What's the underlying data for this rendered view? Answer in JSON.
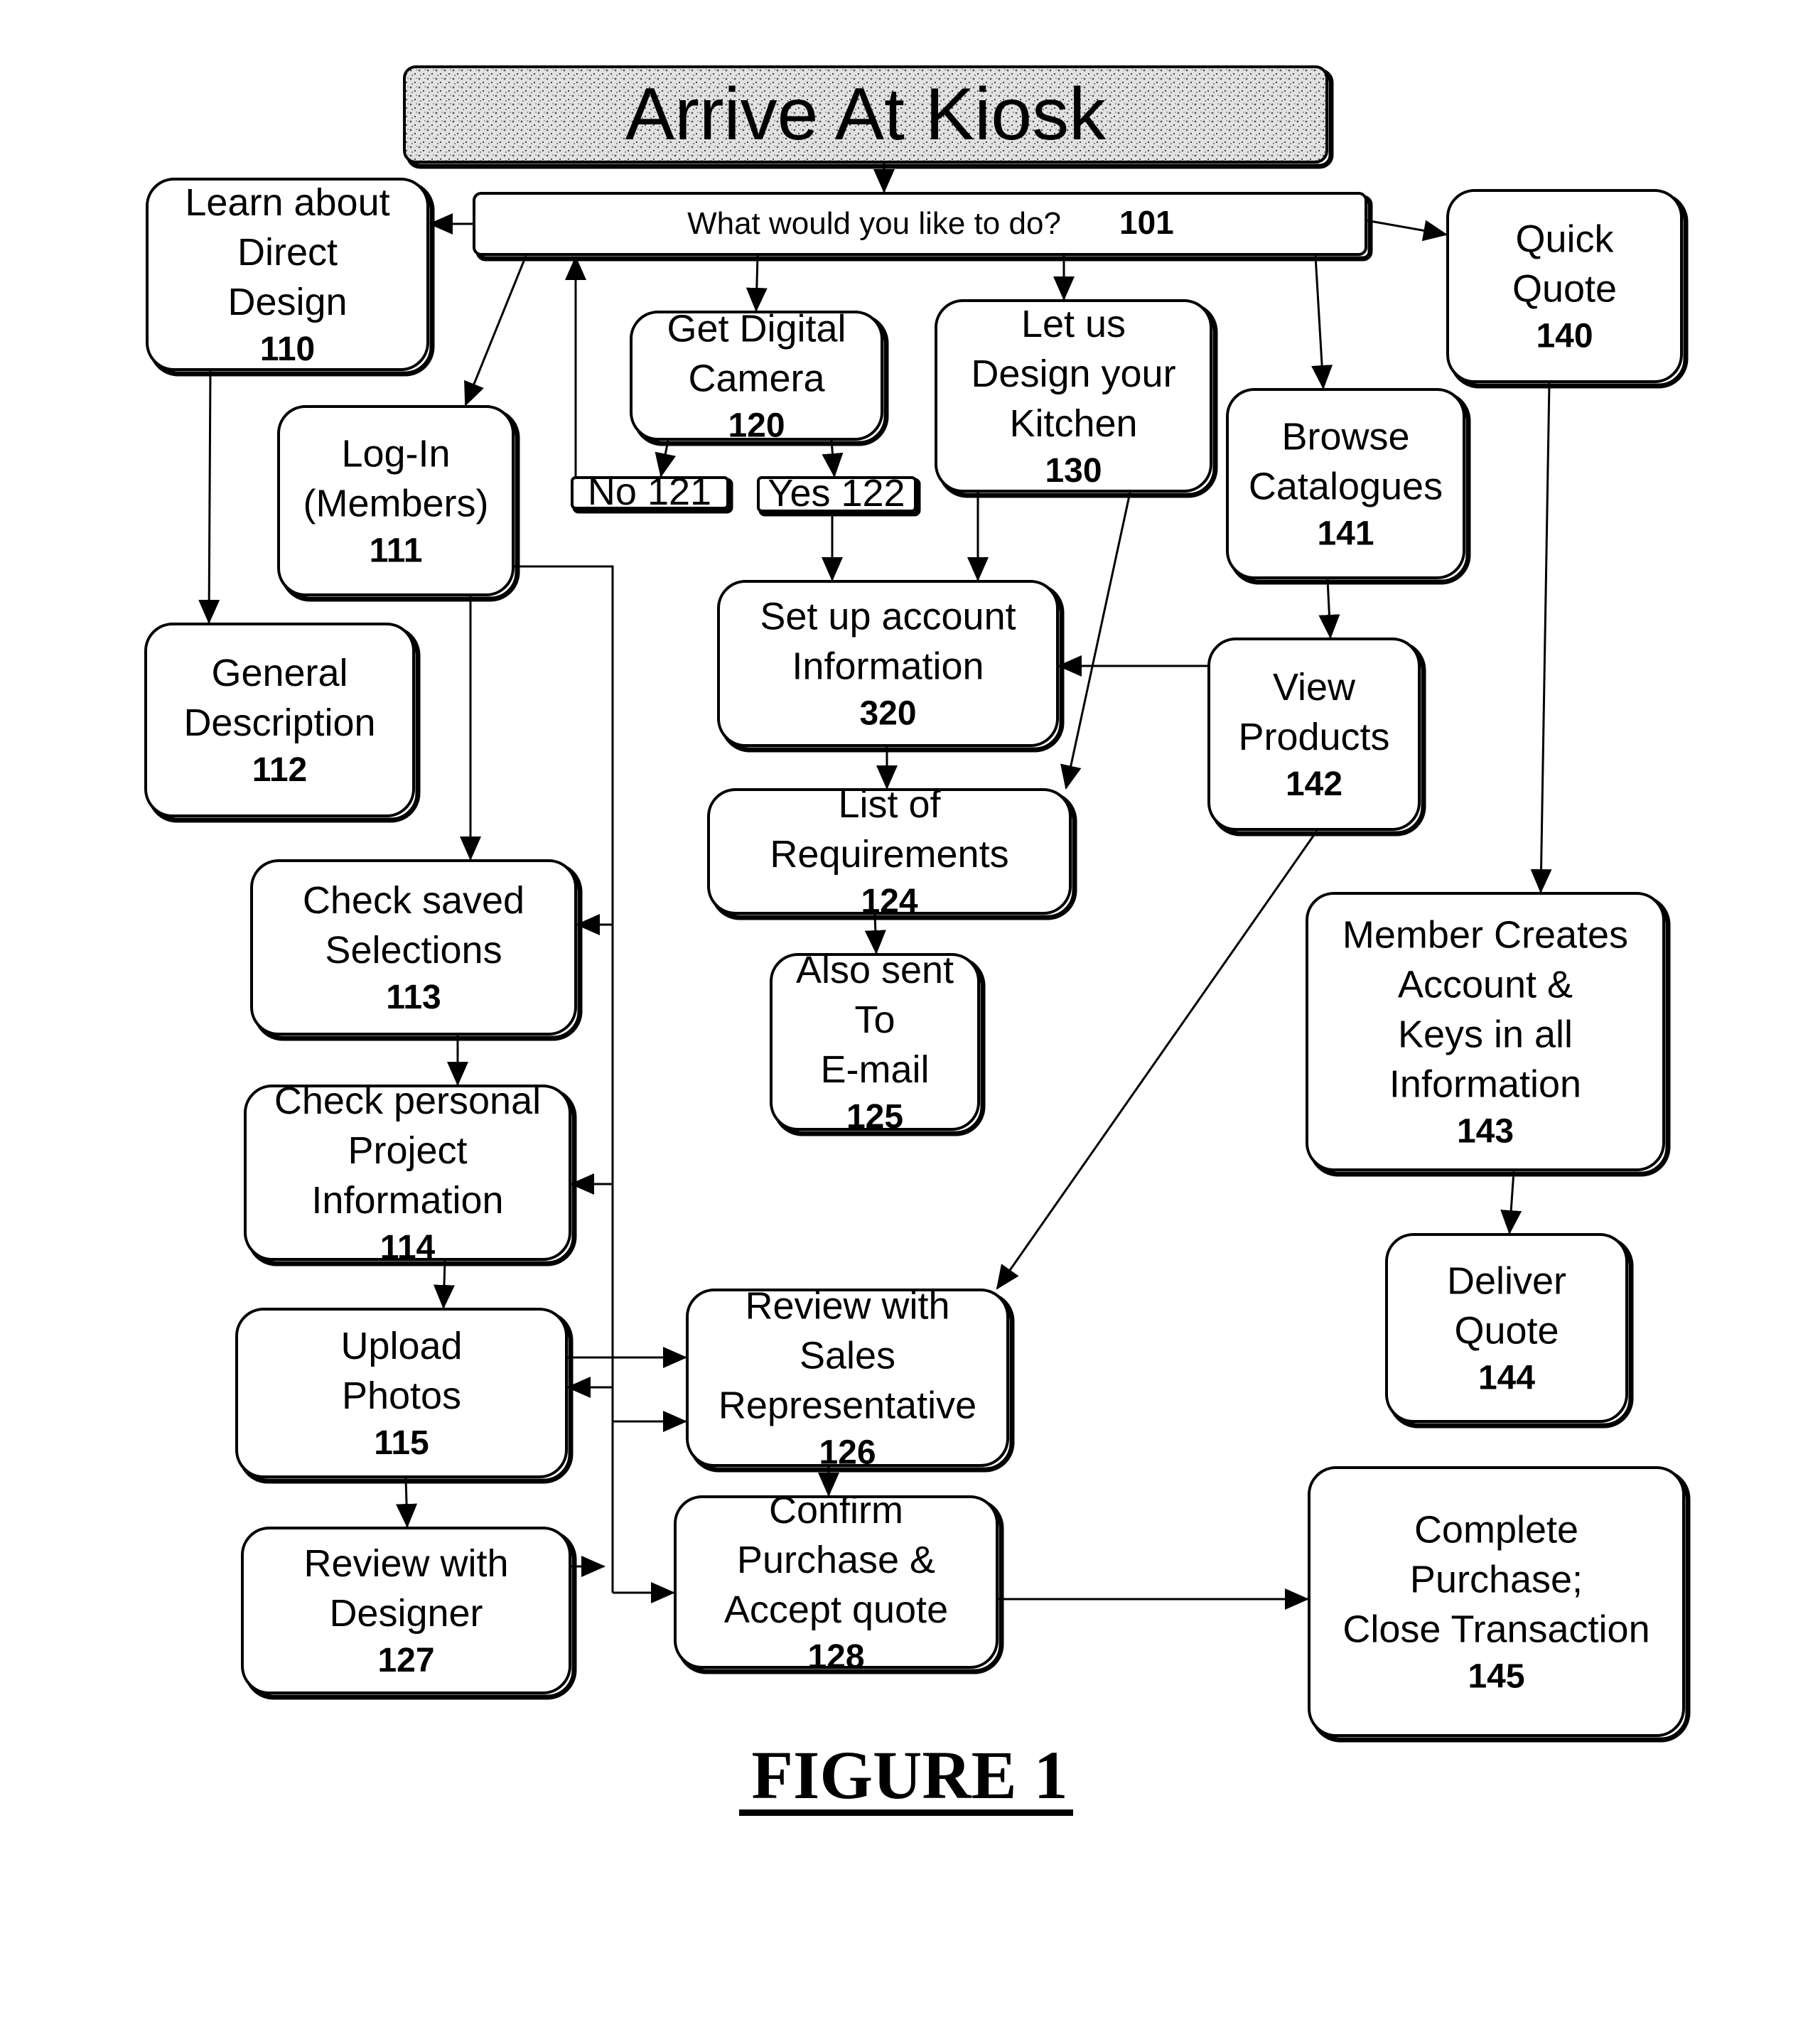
{
  "title": {
    "label": "Arrive At Kiosk"
  },
  "question": {
    "label": "What would you like to do?",
    "ref": "101"
  },
  "nodes": {
    "n110": {
      "lines": [
        "Learn about",
        "Direct",
        "Design"
      ],
      "ref": "110"
    },
    "n111": {
      "lines": [
        "Log-In",
        "(Members)"
      ],
      "ref": "111"
    },
    "n112": {
      "lines": [
        "General",
        "Description"
      ],
      "ref": "112"
    },
    "n113": {
      "lines": [
        "Check saved",
        "Selections"
      ],
      "ref": "113"
    },
    "n114": {
      "lines": [
        "Check personal",
        "Project",
        "Information"
      ],
      "ref": "114"
    },
    "n115": {
      "lines": [
        "Upload",
        "Photos"
      ],
      "ref": "115"
    },
    "n127": {
      "lines": [
        "Review with",
        "Designer"
      ],
      "ref": "127"
    },
    "n120": {
      "lines": [
        "Get Digital",
        "Camera"
      ],
      "ref": "120"
    },
    "n121": {
      "label": "No 121"
    },
    "n122": {
      "label": "Yes 122"
    },
    "n130": {
      "lines": [
        "Let us",
        "Design your",
        "Kitchen"
      ],
      "ref": "130"
    },
    "n320": {
      "lines": [
        "Set up account",
        "Information"
      ],
      "ref": "320"
    },
    "n124": {
      "lines": [
        "List of",
        "Requirements"
      ],
      "ref": "124"
    },
    "n125": {
      "lines": [
        "Also sent",
        "To",
        "E-mail"
      ],
      "ref": "125"
    },
    "n126": {
      "lines": [
        "Review with",
        "Sales",
        "Representative"
      ],
      "ref": "126"
    },
    "n128": {
      "lines": [
        "Confirm",
        "Purchase &",
        "Accept quote"
      ],
      "ref": "128"
    },
    "n141": {
      "lines": [
        "Browse",
        "Catalogues"
      ],
      "ref": "141"
    },
    "n142": {
      "lines": [
        "View",
        "Products"
      ],
      "ref": "142"
    },
    "n140": {
      "lines": [
        "Quick",
        "Quote"
      ],
      "ref": "140"
    },
    "n143": {
      "lines": [
        "Member Creates",
        "Account &",
        "Keys in all",
        "Information"
      ],
      "ref": "143"
    },
    "n144": {
      "lines": [
        "Deliver",
        "Quote"
      ],
      "ref": "144"
    },
    "n145": {
      "lines": [
        "Complete",
        "Purchase;",
        "Close Transaction"
      ],
      "ref": "145"
    }
  },
  "edges": [
    [
      "title",
      "101"
    ],
    [
      "101",
      "110"
    ],
    [
      "101",
      "111"
    ],
    [
      "101",
      "120"
    ],
    [
      "101",
      "130"
    ],
    [
      "101",
      "141"
    ],
    [
      "101",
      "140"
    ],
    [
      "110",
      "112"
    ],
    [
      "111",
      "113"
    ],
    [
      "111",
      "bus"
    ],
    [
      "113",
      "114"
    ],
    [
      "114",
      "115"
    ],
    [
      "115",
      "127"
    ],
    [
      "120",
      "121"
    ],
    [
      "120",
      "122"
    ],
    [
      "121",
      "101"
    ],
    [
      "122",
      "320"
    ],
    [
      "130",
      "320"
    ],
    [
      "130",
      "124"
    ],
    [
      "320",
      "124"
    ],
    [
      "124",
      "125"
    ],
    [
      "141",
      "142"
    ],
    [
      "142",
      "320"
    ],
    [
      "142",
      "126"
    ],
    [
      "140",
      "143"
    ],
    [
      "143",
      "144"
    ],
    [
      "115",
      "126"
    ],
    [
      "126",
      "128"
    ],
    [
      "128",
      "145"
    ]
  ],
  "caption": {
    "label": "FIGURE 1"
  }
}
